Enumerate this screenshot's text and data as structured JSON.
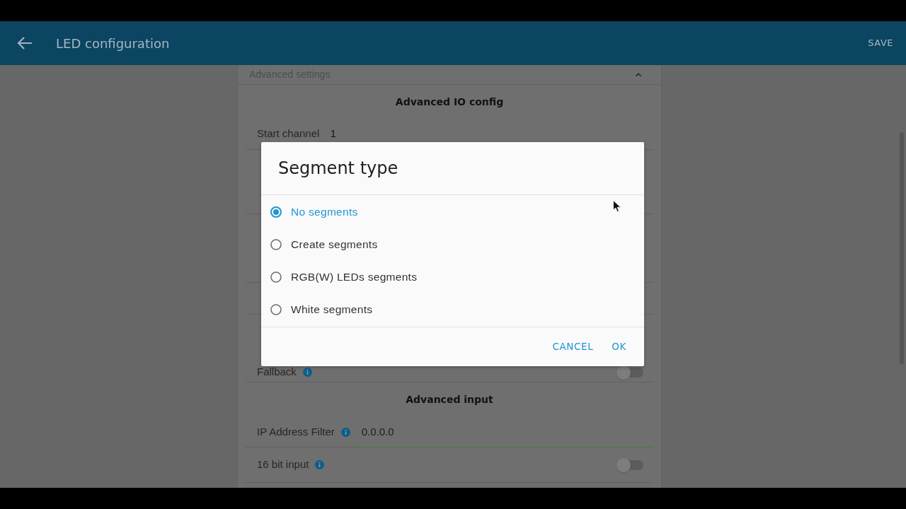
{
  "app_bar": {
    "title": "LED configuration",
    "action": "SAVE"
  },
  "panel": {
    "header": {
      "label": "Advanced settings",
      "expanded": true
    },
    "sections": [
      {
        "heading": "Advanced IO config",
        "rows": [
          {
            "kind": "field",
            "label": "Start channel",
            "value": "1"
          },
          {
            "kind": "toggle",
            "label": "Fallback",
            "info": true,
            "on": false
          }
        ]
      },
      {
        "heading": "Advanced input",
        "rows": [
          {
            "kind": "field",
            "label": "IP Address Filter",
            "info": true,
            "value": "0.0.0.0",
            "valid": true
          },
          {
            "kind": "toggle",
            "label": "16 bit input",
            "info": true,
            "on": false
          }
        ]
      }
    ]
  },
  "dialog": {
    "title": "Segment type",
    "options": [
      {
        "label": "No segments",
        "selected": true
      },
      {
        "label": "Create segments",
        "selected": false
      },
      {
        "label": "RGB(W) LEDs segments",
        "selected": false
      },
      {
        "label": "White segments",
        "selected": false
      }
    ],
    "buttons": [
      "CANCEL",
      "OK"
    ]
  }
}
